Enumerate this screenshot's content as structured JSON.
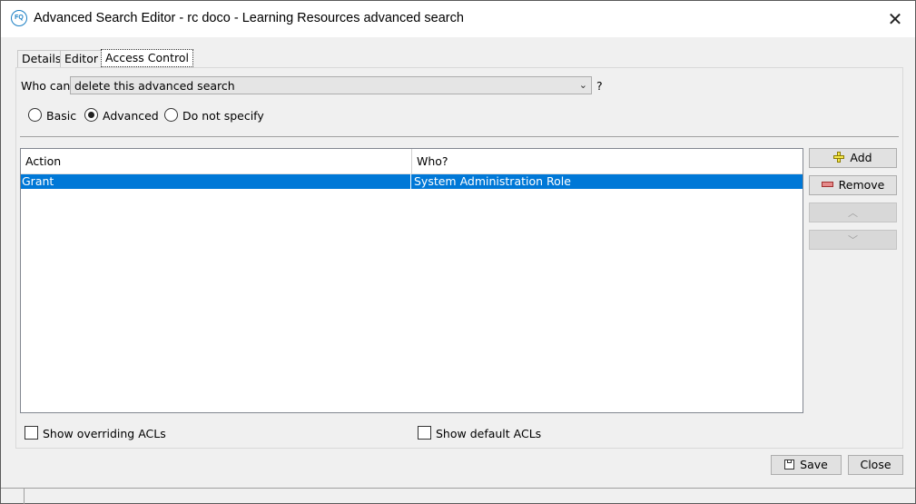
{
  "window": {
    "title": "Advanced Search Editor - rc doco - Learning Resources advanced search",
    "app_icon_text": "FQ"
  },
  "tabs": [
    {
      "label": "Details",
      "active": false
    },
    {
      "label": "Editor",
      "active": false
    },
    {
      "label": "Access Control",
      "active": true
    }
  ],
  "access": {
    "who_can_label": "Who can",
    "who_can_value": "delete this advanced search",
    "help_mark": "?",
    "modes": [
      {
        "label": "Basic",
        "checked": false
      },
      {
        "label": "Advanced",
        "checked": true
      },
      {
        "label": "Do not specify",
        "checked": false
      }
    ]
  },
  "table": {
    "columns": [
      "Action",
      "Who?"
    ],
    "rows": [
      {
        "action": "Grant",
        "who": "System Administration Role",
        "selected": true
      }
    ]
  },
  "side_buttons": {
    "add": "Add",
    "remove": "Remove"
  },
  "options": {
    "show_overriding": "Show overriding ACLs",
    "show_default": "Show default ACLs"
  },
  "footer": {
    "save": "Save",
    "close": "Close"
  },
  "colors": {
    "selection": "#0078d7",
    "app_icon": "#1b7fc4"
  }
}
